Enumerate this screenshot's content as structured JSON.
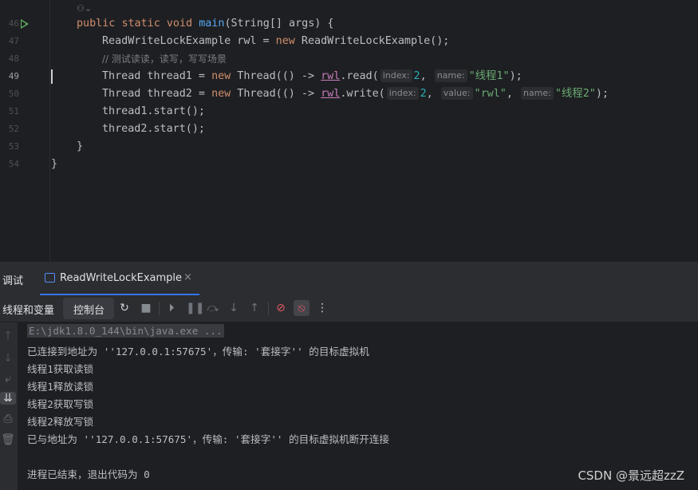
{
  "editor": {
    "line_numbers": [
      "46",
      "47",
      "48",
      "49",
      "50",
      "51",
      "52",
      "53",
      "54"
    ],
    "lines": {
      "l46": {
        "kw1": "public",
        "kw2": "static",
        "kw3": "void",
        "method": "main",
        "rest": "(String[] args) {"
      },
      "l47": {
        "t1": "ReadWriteLockExample rwl = ",
        "kw": "new",
        "t2": " ReadWriteLockExample();"
      },
      "l48": {
        "comment": "// 测试读读，读写，写写场景"
      },
      "l49": {
        "t1": "Thread thread1 = ",
        "kw": "new",
        "t2": " Thread(() -> ",
        "field": "rwl",
        "t3": ".read(",
        "hint1": "index:",
        "num": "2",
        "t4": ", ",
        "hint2": "name:",
        "str": "\"线程1\"",
        "t5": ");"
      },
      "l50": {
        "t1": "Thread thread2 = ",
        "kw": "new",
        "t2": " Thread(() -> ",
        "field": "rwl",
        "t3": ".write(",
        "hint1": "index:",
        "num": "2",
        "t4": ", ",
        "hint2": "value:",
        "str1": "\"rwl\"",
        "t5": ", ",
        "hint3": "name:",
        "str2": "\"线程2\"",
        "t6": ");"
      },
      "l51": {
        "t1": "thread1.start();"
      },
      "l52": {
        "t1": "thread2.start();"
      },
      "l53": {
        "t1": "}"
      },
      "l54": {
        "t1": "}"
      }
    }
  },
  "debug": {
    "title": "调试",
    "run_tab_label": "ReadWriteLockExample",
    "tabs": {
      "threads": "线程和变量",
      "console": "控制台"
    }
  },
  "console": {
    "lines": [
      "E:\\jdk1.8.0_144\\bin\\java.exe ...",
      "已连接到地址为 ''127.0.0.1:57675'，传输: '套接字'' 的目标虚拟机",
      "线程1获取读锁",
      "线程1释放读锁",
      "线程2获取写锁",
      "线程2释放写锁",
      "已与地址为 ''127.0.0.1:57675'，传输: '套接字'' 的目标虚拟机断开连接",
      "",
      "进程已结束，退出代码为 0"
    ]
  },
  "watermark": "CSDN @景远超zzZ",
  "colors": {
    "accent": "#3574f0",
    "keyword": "#cf8e6d",
    "string": "#6aab73",
    "number": "#2aacb8",
    "method": "#56a8f5",
    "field": "#c77dbb"
  }
}
